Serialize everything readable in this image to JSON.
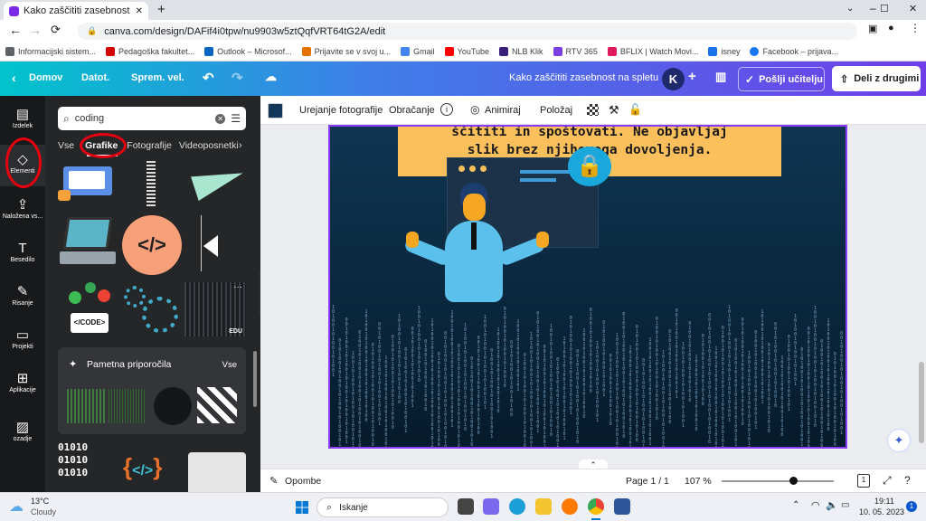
{
  "browser": {
    "tab_title": "Kako zaščititi zasebnost na splet",
    "url": "canva.com/design/DAFif4i0tpw/nu9903w5ztQqfVRT64tG2A/edit",
    "bookmarks": [
      "Informacijski sistem...",
      "Pedagoška fakultet...",
      "Outlook – Microsof...",
      "Prijavite se v svoj u...",
      "Gmail",
      "YouTube",
      "NLB Klik",
      "RTV 365",
      "BFLIX | Watch Movi...",
      "isney",
      "Facebook – prijava..."
    ]
  },
  "header": {
    "home": "Domov",
    "file": "Datot.",
    "resize": "Sprem. vel.",
    "design_title": "Kako zaščititi zasebnost na spletu",
    "avatar": "K",
    "send_teacher": "Pošlji učitelju",
    "share": "Deli z drugimi"
  },
  "rail": [
    {
      "label": "Izdelek",
      "icon": "layout-icon"
    },
    {
      "label": "Elementi",
      "icon": "shapes-icon"
    },
    {
      "label": "Naložena vs...",
      "icon": "upload-icon"
    },
    {
      "label": "Besedilo",
      "icon": "text-icon"
    },
    {
      "label": "Risanje",
      "icon": "draw-icon"
    },
    {
      "label": "Projekti",
      "icon": "folder-icon"
    },
    {
      "label": "Aplikacije",
      "icon": "apps-icon"
    },
    {
      "label": "ozadje",
      "icon": "background-icon"
    }
  ],
  "panel": {
    "search_value": "coding",
    "categories": [
      "Vse",
      "Grafike",
      "Fotografije",
      "Videoposnetki"
    ],
    "code_label": "</CODE>",
    "edu_badge": "EDU",
    "smart_title": "Pametna priporočila",
    "smart_all": "Vse",
    "binary_text": "01010 01010 01010"
  },
  "toolbar": {
    "edit_photo": "Urejanje fotografije",
    "crop": "Obračanje",
    "animate": "Animiraj",
    "position": "Položaj"
  },
  "design": {
    "line1": "ščititi in spoštovati. Ne objavljaj",
    "line2": "slik brez njihovega dovoljenja."
  },
  "bottom": {
    "notes": "Opombe",
    "page": "Page 1 / 1",
    "zoom": "107 %"
  },
  "taskbar": {
    "temp": "13°C",
    "weather": "Cloudy",
    "search": "Iskanje",
    "time": "19:11",
    "date": "10. 05. 2023"
  }
}
